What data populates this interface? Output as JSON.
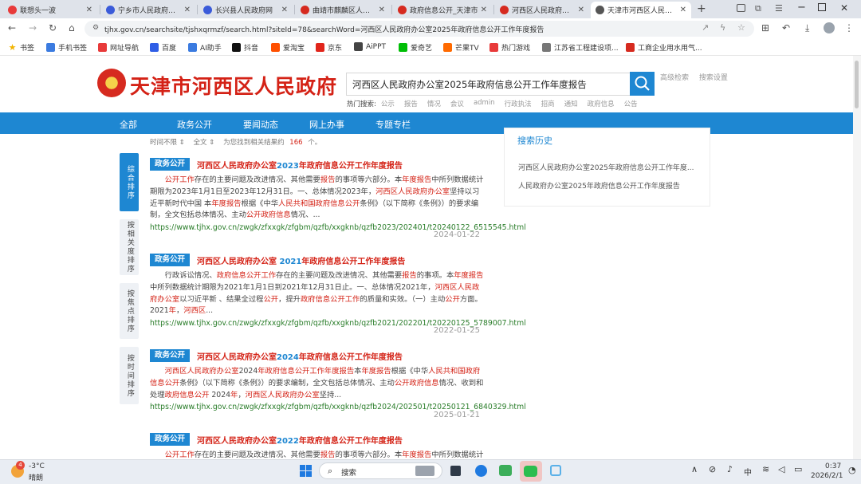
{
  "browser": {
    "tabs": [
      {
        "title": "联想头一波",
        "icon_color": "#e83a3a"
      },
      {
        "title": "宁乡市人民政府办公室",
        "icon_color": "#3b5bd9"
      },
      {
        "title": "长兴县人民政府网",
        "icon_color": "#3b5bd9"
      },
      {
        "title": "曲靖市麒麟区人民政府",
        "icon_color": "#d62a1f"
      },
      {
        "title": "政府信息公开_天津市",
        "icon_color": "#d62a1f"
      },
      {
        "title": "河西区人民政府办公室",
        "icon_color": "#d62a1f"
      },
      {
        "title": "天津市河西区人民政府",
        "icon_color": "#555555"
      }
    ],
    "url": "tjhx.gov.cn/searchsite/tjshxqrmzf/search.html?siteId=78&searchWord=河西区人民政府办公室2025年政府信息公开工作年度报告",
    "bookmarks": [
      {
        "label": "书签",
        "color": "#f2b400"
      },
      {
        "label": "手机书签",
        "color": "#3b7be0"
      },
      {
        "label": "网址导航",
        "color": "#e83a3a"
      },
      {
        "label": "百度",
        "color": "#2f5ee6"
      },
      {
        "label": "AI助手",
        "color": "#3b7be0"
      },
      {
        "label": "抖音",
        "color": "#111111"
      },
      {
        "label": "爱淘宝",
        "color": "#ff5000"
      },
      {
        "label": "京东",
        "color": "#e1251b"
      },
      {
        "label": "AiPPT",
        "color": "#444444"
      },
      {
        "label": "爱奇艺",
        "color": "#00be06"
      },
      {
        "label": "芒果TV",
        "color": "#ff6a00"
      },
      {
        "label": "热门游戏",
        "color": "#e83a3a"
      },
      {
        "label": "江苏省工程建设项...",
        "color": "#777777"
      },
      {
        "label": "工商企业用水用气...",
        "color": "#d62a1f"
      }
    ]
  },
  "site": {
    "name": "天津市河西区人民政府",
    "search_value": "河西区人民政府办公室2025年政府信息公开工作年度报告",
    "adv_search": "高级检索",
    "search_settings": "搜索设置",
    "hot_label": "热门搜索:",
    "hot_words": [
      "公示",
      "报告",
      "情况",
      "会议",
      "admin",
      "行政执法",
      "招商",
      "通知",
      "政府信息",
      "公告"
    ],
    "nav": [
      "全部",
      "政务公开",
      "要闻动态",
      "网上办事",
      "专题专栏"
    ],
    "filter_time": "时间不限 ⇕",
    "filter_scope": "全文 ⇕",
    "filter_prefix": "为您找到相关结果约",
    "filter_count": "166",
    "filter_suffix": "个。",
    "sort": [
      "综合排序",
      "按相关度排序",
      "按焦点排序",
      "按时间排序"
    ],
    "badge": "政务公开",
    "history_title": "搜索历史",
    "history": [
      "河西区人民政府办公室2025年政府信息公开工作年度...",
      "人民政府办公室2025年政府信息公开工作年度报告"
    ],
    "results": [
      {
        "t1": "河西区人民政府办公室",
        "t2": "2023",
        "t3": "年政府信息公开工作年度报告",
        "snippet": "<span class=\"red\">公开工作</span>存在的主要问题及改进情况、其他需要<span class=\"red\">报告</span>的事项等六部分。本<span class=\"red\">年度报告</span>中所列数据统计期限为2023年1月1日至2023年12月31日。一、总体情况2023年，<span class=\"red\">河西区人民政府办公室</span>坚持以习近平新时代中国 本<span class=\"red\">年度报告</span>根据《中华<span class=\"red\">人民共和国政府信息公开</span>条例》（以下简称《条例》）的要求编制，全文包括总体情况、主动<span class=\"red\">公开政府信息</span>情况、...",
        "url": "https://www.tjhx.gov.cn/zwgk/zfxxgk/zfgbm/qzfb/xxgknb/qzfb2023/202401/t20240122_6515545.html",
        "date": "2024-01-22"
      },
      {
        "t1": "河西区人民政府办公室",
        "t2": " 2021",
        "t3": "年政府信息公开工作年度报告",
        "snippet": "行政诉讼情况、<span class=\"red\">政府信息公开工作</span>存在的主要问题及改进情况、其他需要<span class=\"red\">报告</span>的事项。本<span class=\"red\">年度报告</span>中所列数据统计期限为2021年1月1日到2021年12月31日止。一、总体情况2021年，<span class=\"red\">河西区人民政府办公室</span>以习近平新 、结果全过程<span class=\"red\">公开</span>，提升<span class=\"red\">政府信息公开工作</span>的质量和实效。（一）主动<span class=\"red\">公开</span>方面。2021<span class=\"red\">年</span>，<span class=\"red\">河西区</span>...",
        "url": "https://www.tjhx.gov.cn/zwgk/zfxxgk/zfgbm/qzfb/xxgknb/qzfb2021/202201/t20220125_5789007.html",
        "date": "2022-01-25"
      },
      {
        "t1": "河西区人民政府办公室",
        "t2": "2024",
        "t3": "年政府信息公开工作年度报告",
        "snippet": "<span class=\"red\">河西区人民政府办公室</span>2024<span class=\"red\">年政府信息公开工作年度报告</span>本<span class=\"red\">年度报告</span>根据《中华<span class=\"red\">人民共和国政府信息公开</span>条例》（以下简称《条例》）的要求编制，全文包括总体情况、主动<span class=\"red\">公开政府信息</span>情况、收到和处理<span class=\"red\">政府信息公开</span> 2024<span class=\"red\">年</span>，<span class=\"red\">河西区人民政府办公室</span>坚持...",
        "url": "https://www.tjhx.gov.cn/zwgk/zfxxgk/zfgbm/qzfb/xxgknb/qzfb2024/202501/t20250121_6840329.html",
        "date": "2025-01-21"
      },
      {
        "t1": "河西区人民政府办公室",
        "t2": "2022",
        "t3": "年政府信息公开工作年度报告",
        "snippet": "<span class=\"red\">公开工作</span>存在的主要问题及改进情况、其他需要<span class=\"red\">报告</span>的事项等六部分。本<span class=\"red\">年度报告</span>中所列数据统计期限",
        "url": "",
        "date": ""
      }
    ]
  },
  "taskbar": {
    "weather_temp": "-3°C",
    "weather_desc": "晴朗",
    "weather_badge": "4",
    "search_label": "搜索",
    "ime": "中",
    "time": "0:37",
    "date": "2026/2/1"
  }
}
